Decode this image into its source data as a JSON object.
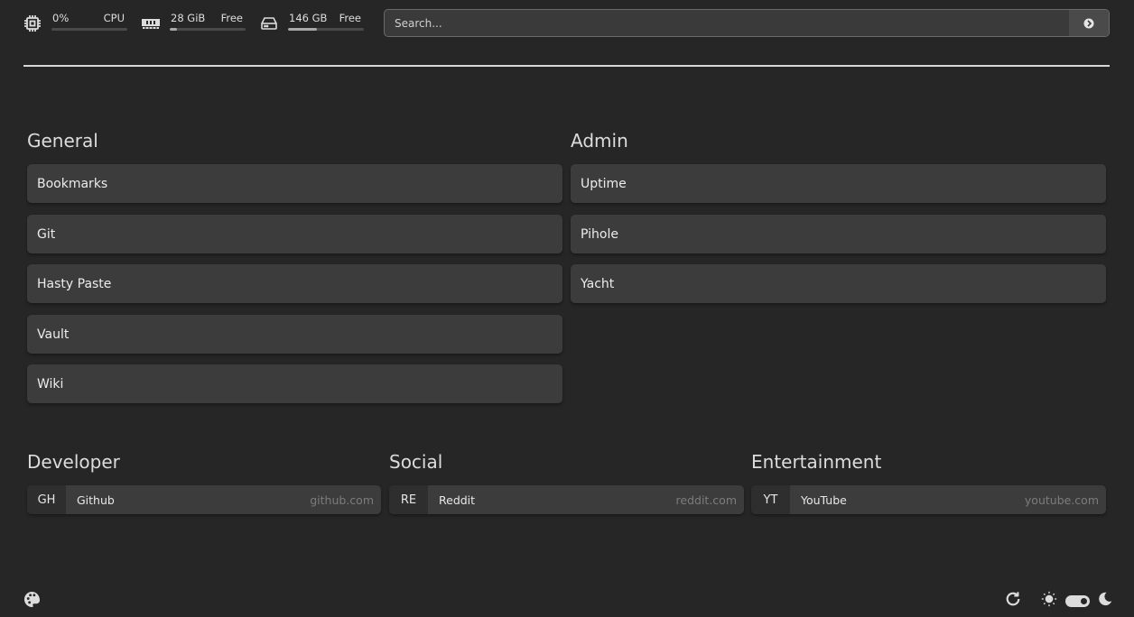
{
  "stats": {
    "cpu": {
      "value": "0%",
      "label": "CPU",
      "percent": 0
    },
    "memory": {
      "value": "28 GiB",
      "label": "Free",
      "percent": 10
    },
    "disk": {
      "value": "146 GB",
      "label": "Free",
      "percent": 38
    }
  },
  "search": {
    "placeholder": "Search..."
  },
  "groups": {
    "general": {
      "title": "General",
      "items": [
        "Bookmarks",
        "Git",
        "Hasty Paste",
        "Vault",
        "Wiki"
      ]
    },
    "admin": {
      "title": "Admin",
      "items": [
        "Uptime",
        "Pihole",
        "Yacht"
      ]
    }
  },
  "bookmark_groups": {
    "developer": {
      "title": "Developer",
      "items": [
        {
          "abbr": "GH",
          "name": "Github",
          "url": "github.com"
        }
      ]
    },
    "social": {
      "title": "Social",
      "items": [
        {
          "abbr": "RE",
          "name": "Reddit",
          "url": "reddit.com"
        }
      ]
    },
    "entertainment": {
      "title": "Entertainment",
      "items": [
        {
          "abbr": "YT",
          "name": "YouTube",
          "url": "youtube.com"
        }
      ]
    }
  },
  "theme": {
    "mode": "dark"
  }
}
